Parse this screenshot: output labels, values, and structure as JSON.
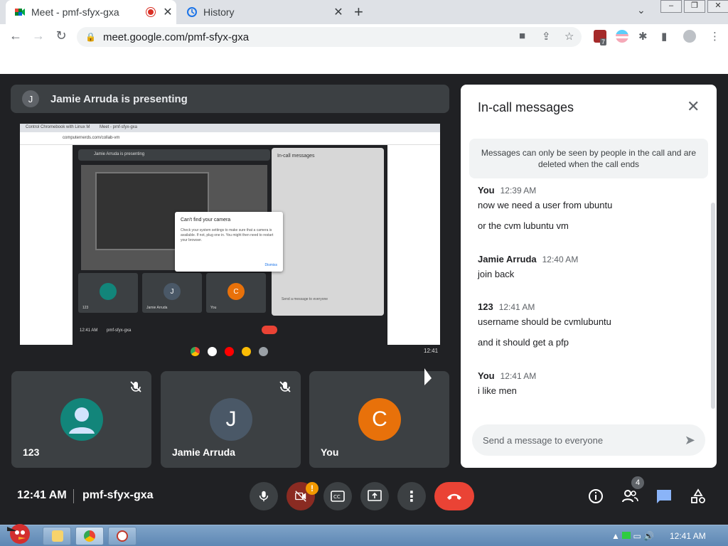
{
  "browser": {
    "tabs": [
      {
        "title": "Meet - pmf-sfyx-gxa",
        "close": "✕"
      },
      {
        "title": "History",
        "close": "✕"
      }
    ],
    "new_tab": "+",
    "url": "meet.google.com/pmf-sfyx-gxa",
    "ext_badge": "7"
  },
  "meet": {
    "presenter_initial": "J",
    "presenting_text": "Jamie Arruda is presenting",
    "participants": [
      {
        "name": "123",
        "initial": "",
        "color": "#12857a"
      },
      {
        "name": "Jamie Arruda",
        "initial": "J",
        "color": "#4a5867"
      },
      {
        "name": "You",
        "initial": "C",
        "color": "#e8710a"
      }
    ],
    "time": "12:41 AM",
    "meeting_code": "pmf-sfyx-gxa",
    "people_count": "4",
    "camera_warning": "!"
  },
  "shared_screen": {
    "tab1": "Control Chromebook with Linux M",
    "tab2": "Meet - pmf-sfyx-gxa",
    "url": "computernerds.com/collab-vm",
    "presenting_text": "Jamie Arruda is presenting",
    "chat_title": "In-call messages",
    "dialog_title": "Can't find your camera",
    "dialog_body": "Check your system settings to make sure that a camera is available. If not, plug one in. You might then need to restart your browser.",
    "dialog_button": "Dismiss",
    "tile_names": [
      "123",
      "Jamie Arruda",
      "You"
    ],
    "tile_initials": [
      "",
      "J",
      "C"
    ],
    "bottom_time": "12:41 AM",
    "bottom_code": "pmf-sfyx-gxa",
    "shelf_time": "12:41",
    "chat_placeholder": "Send a message to everyone"
  },
  "chat": {
    "title": "In-call messages",
    "notice": "Messages can only be seen by people in the call and are deleted when the call ends",
    "messages": [
      {
        "sender": "You",
        "time": "12:39 AM",
        "lines": [
          "now we need a user from ubuntu",
          "or the cvm lubuntu vm"
        ]
      },
      {
        "sender": "Jamie Arruda",
        "time": "12:40 AM",
        "lines": [
          "join back"
        ]
      },
      {
        "sender": "123",
        "time": "12:41 AM",
        "lines": [
          "username should be cvmlubuntu",
          "and it should get a pfp"
        ]
      },
      {
        "sender": "You",
        "time": "12:41 AM",
        "lines": [
          "i like men"
        ]
      }
    ],
    "placeholder": "Send a message to everyone"
  },
  "taskbar": {
    "clock": "12:41 AM"
  }
}
